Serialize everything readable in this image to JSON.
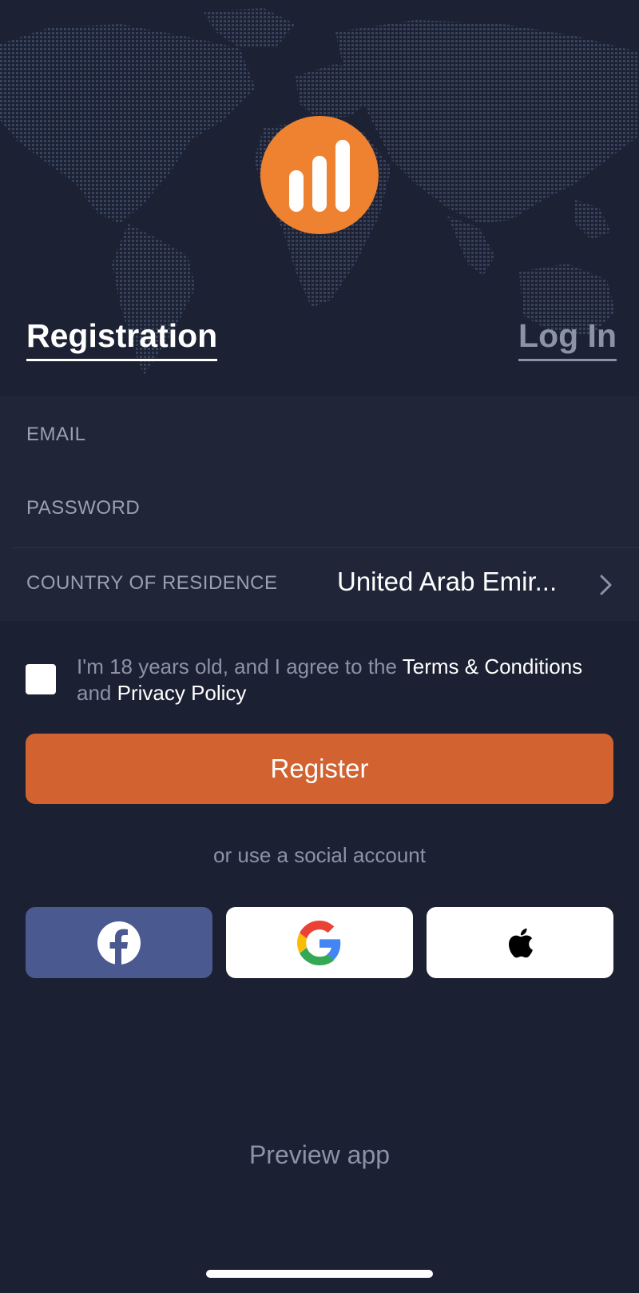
{
  "header": {
    "logo_icon": "bar-chart-logo-icon",
    "accent_color": "#ef8230"
  },
  "tabs": {
    "registration": "Registration",
    "login": "Log In"
  },
  "form": {
    "email_label": "EMAIL",
    "password_label": "PASSWORD",
    "country_label": "COUNTRY OF RESIDENCE",
    "country_value": "United Arab Emir..."
  },
  "agreement": {
    "prefix": "I'm 18 years old, and I agree to the ",
    "terms": "Terms & Conditions",
    "conjunction": " and ",
    "privacy": "Privacy Policy"
  },
  "register_button": {
    "label": "Register",
    "color": "#d2622f"
  },
  "social": {
    "caption": "or use a social account",
    "buttons": [
      {
        "icon": "facebook-icon"
      },
      {
        "icon": "google-icon"
      },
      {
        "icon": "apple-icon"
      }
    ]
  },
  "preview": {
    "label": "Preview app"
  }
}
